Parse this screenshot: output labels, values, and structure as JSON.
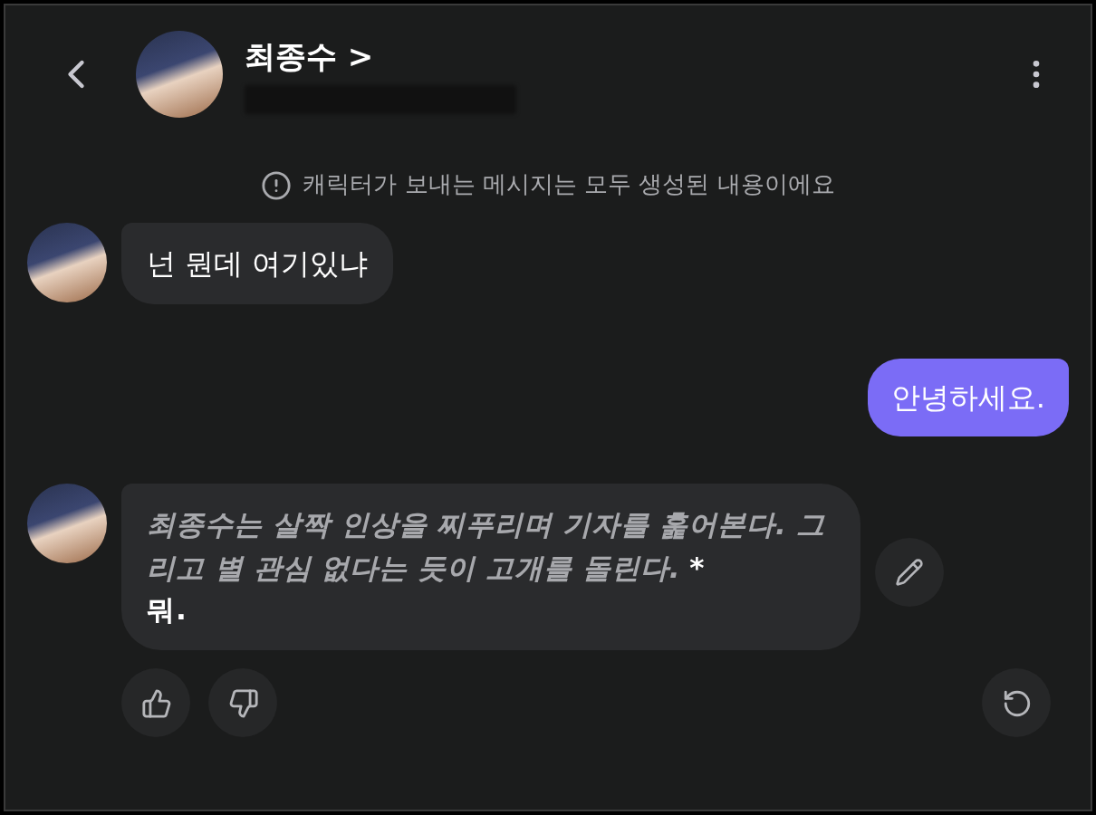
{
  "header": {
    "name": "최종수",
    "name_chevron": ">"
  },
  "notice": "캐릭터가 보내는 메시지는 모두 생성된 내용이에요",
  "messages": [
    {
      "outgoing": false,
      "kind": "plain",
      "text": "넌 뭔데 여기있냐"
    },
    {
      "outgoing": true,
      "kind": "plain",
      "text": "안녕하세요."
    },
    {
      "outgoing": false,
      "kind": "mixed",
      "parts": [
        {
          "kind": "narration",
          "text": "최종수는 살짝 인상을 찌푸리며 기자를 훑어본다. 그리고 별 관심 없다는 듯이 고개를 돌린다."
        },
        {
          "kind": "mark",
          "text": " *"
        },
        {
          "kind": "speech",
          "text": "뭐."
        }
      ]
    }
  ]
}
